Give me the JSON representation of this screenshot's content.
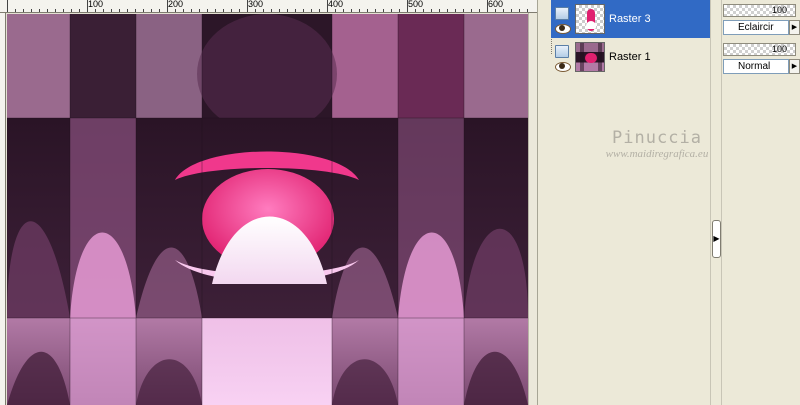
{
  "ruler": {
    "labels": [
      "100",
      "200",
      "300",
      "400",
      "500",
      "600"
    ]
  },
  "layers": [
    {
      "name": "Raster 3",
      "selected": true,
      "thumb": "pink-oval-on-transparent"
    },
    {
      "name": "Raster 1",
      "selected": false,
      "thumb": "pink-pattern"
    }
  ],
  "properties": [
    {
      "opacity": "100",
      "blend_mode": "Eclaircir"
    },
    {
      "opacity": "100",
      "blend_mode": "Normal"
    }
  ],
  "watermark": {
    "name": "Pinuccia",
    "url": "www.maidiregrafica.eu"
  },
  "icons": {
    "layer_type": "raster-layer-icon",
    "visibility": "eye-icon",
    "splitter": "arrow-right-icon",
    "dropdown": "triangle-right-icon"
  },
  "colors": {
    "selection": "#316ac5",
    "hot_pink": "#ee3a8c",
    "dark_plum": "#2a1426"
  }
}
